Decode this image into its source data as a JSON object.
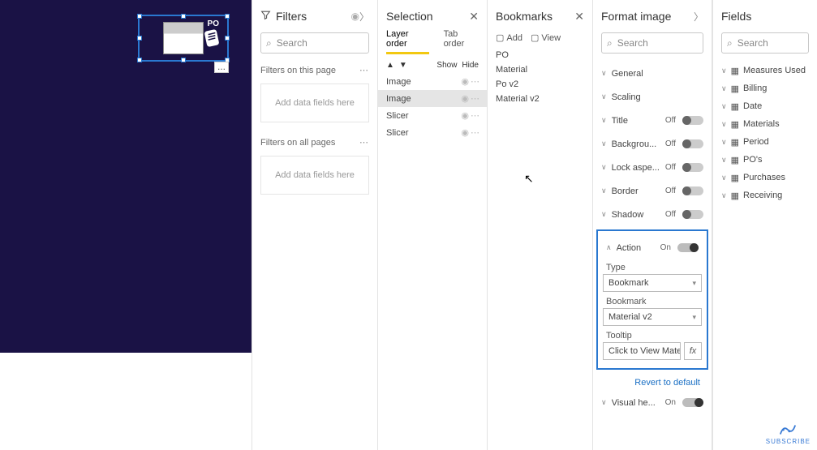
{
  "canvas": {
    "po_label": "PO",
    "ellipsis": "..."
  },
  "filters": {
    "title": "Filters",
    "search_placeholder": "Search",
    "group_page": "Filters on this page",
    "group_all": "Filters on all pages",
    "dropzone_text": "Add data fields here"
  },
  "selection": {
    "title": "Selection",
    "tabs": {
      "layer": "Layer order",
      "tab": "Tab order"
    },
    "show": "Show",
    "hide": "Hide",
    "items": [
      {
        "label": "Image",
        "selected": false
      },
      {
        "label": "Image",
        "selected": true
      },
      {
        "label": "Slicer",
        "selected": false
      },
      {
        "label": "Slicer",
        "selected": false
      }
    ]
  },
  "bookmarks": {
    "title": "Bookmarks",
    "add": "Add",
    "view": "View",
    "items": [
      "PO",
      "Material",
      "Po v2",
      "Material v2"
    ]
  },
  "format": {
    "title": "Format image",
    "search_placeholder": "Search",
    "props": [
      {
        "label": "General",
        "toggle": null
      },
      {
        "label": "Scaling",
        "toggle": null
      },
      {
        "label": "Title",
        "toggle": "Off"
      },
      {
        "label": "Backgrou...",
        "toggle": "Off"
      },
      {
        "label": "Lock aspe...",
        "toggle": "Off"
      },
      {
        "label": "Border",
        "toggle": "Off"
      },
      {
        "label": "Shadow",
        "toggle": "Off"
      }
    ],
    "action": {
      "label": "Action",
      "toggle": "On",
      "type_label": "Type",
      "type_value": "Bookmark",
      "bookmark_label": "Bookmark",
      "bookmark_value": "Material v2",
      "tooltip_label": "Tooltip",
      "tooltip_value": "Click to View Mate...",
      "fx": "fx"
    },
    "revert": "Revert to default",
    "visual_header": {
      "label": "Visual he...",
      "toggle": "On"
    }
  },
  "fields": {
    "title": "Fields",
    "search_placeholder": "Search",
    "tables": [
      "Measures Used",
      "Billing",
      "Date",
      "Materials",
      "Period",
      "PO's",
      "Purchases",
      "Receiving"
    ]
  },
  "subscribe": "SUBSCRIBE"
}
